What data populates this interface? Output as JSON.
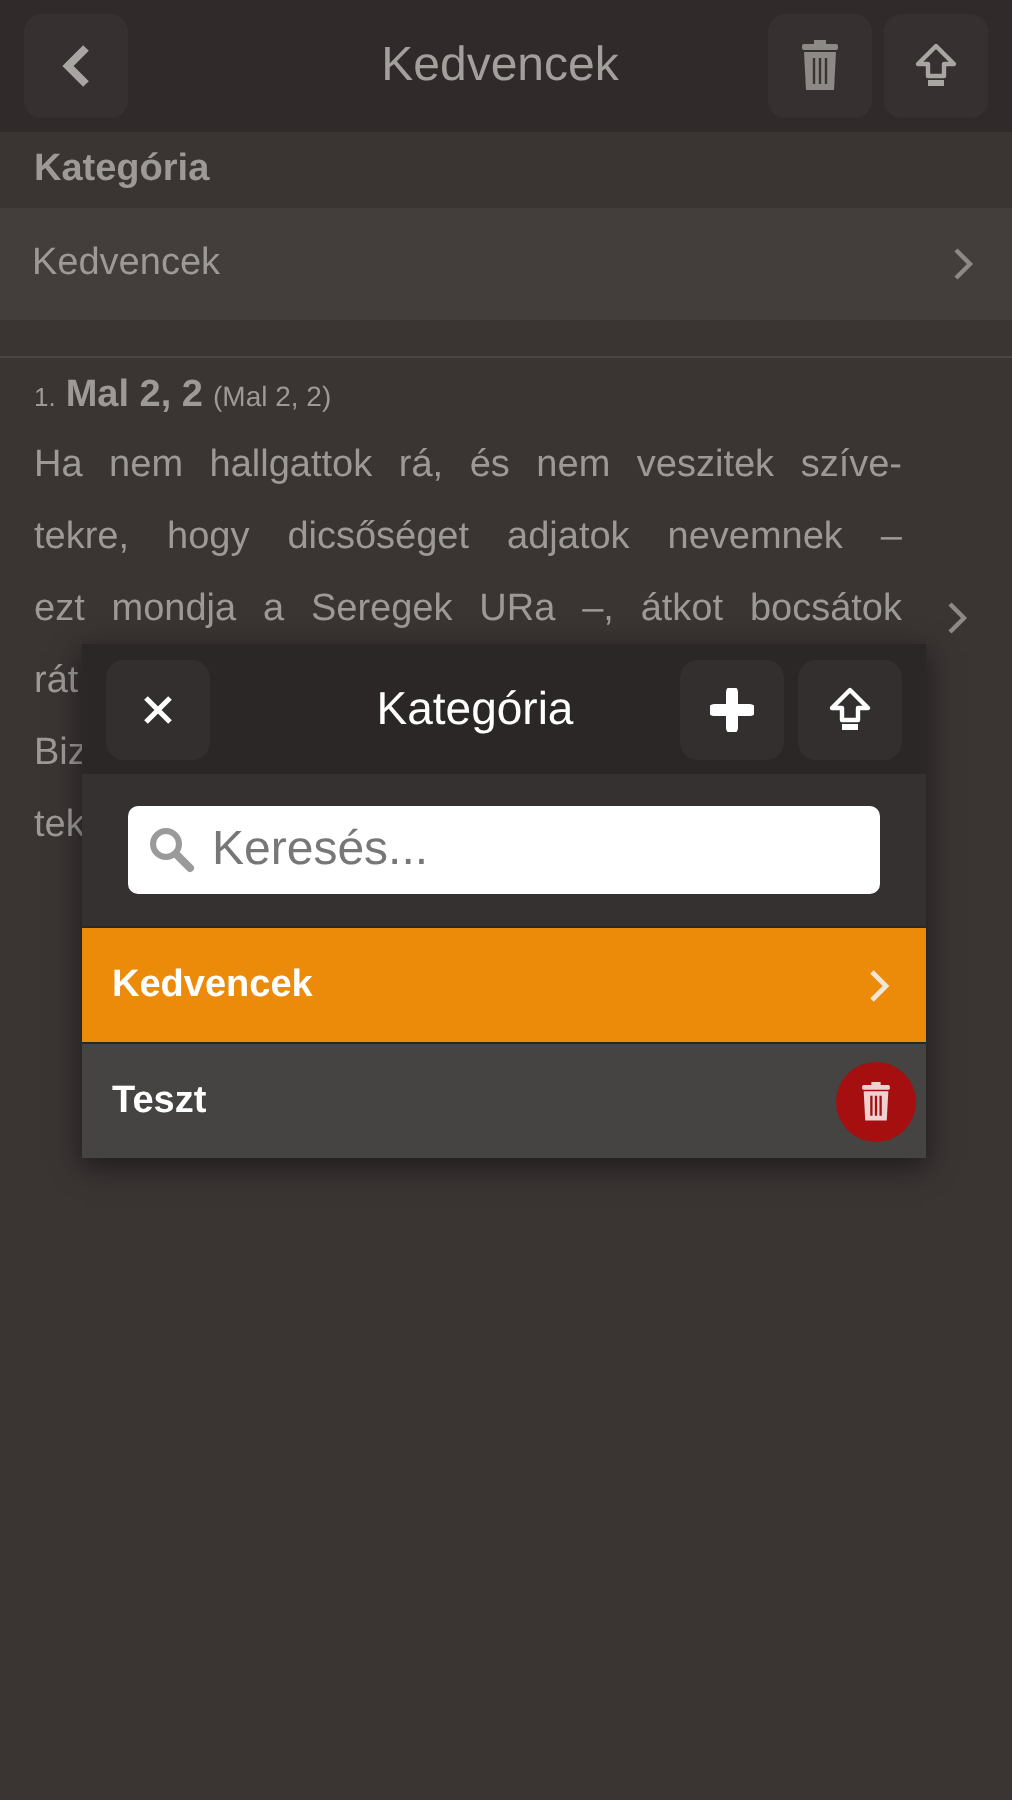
{
  "header": {
    "title": "Kedvencek"
  },
  "category_section": {
    "label": "Kategória",
    "value": "Kedvencek"
  },
  "entries": [
    {
      "number": "1.",
      "reference": "Mal 2, 2",
      "reference_alt": "(Mal 2, 2)",
      "lines": [
        "Ha nem hallgattok rá, és nem veszitek szíve-",
        "tekre, hogy dicsőséget adjatok nevemnek –",
        "ezt mondja a Seregek URa –, átkot bocsátok",
        "rát",
        "Biz",
        "tek"
      ]
    }
  ],
  "popup": {
    "title": "Kategória",
    "search": {
      "placeholder": "Keresés..."
    },
    "items": [
      {
        "label": "Kedvencek",
        "selected": true,
        "kind": "chevron"
      },
      {
        "label": "Teszt",
        "selected": false,
        "kind": "delete"
      }
    ]
  }
}
